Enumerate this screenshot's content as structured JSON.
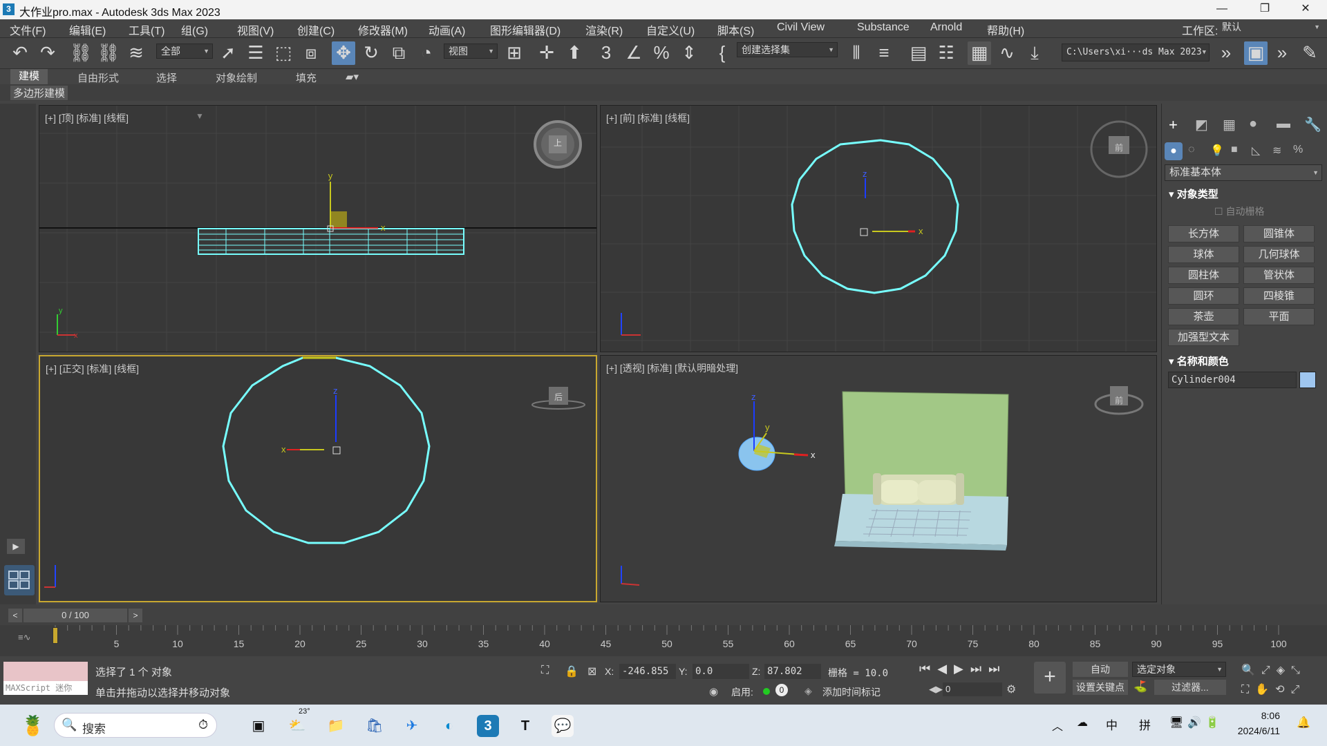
{
  "window": {
    "title": "大作业pro.max - Autodesk 3ds Max 2023",
    "minimize": "—",
    "maximize": "❐",
    "close": "✕"
  },
  "menu": [
    "文件(F)",
    "编辑(E)",
    "工具(T)",
    "组(G)",
    "视图(V)",
    "创建(C)",
    "修改器(M)",
    "动画(A)",
    "图形编辑器(D)",
    "渲染(R)",
    "自定义(U)",
    "脚本(S)",
    "Civil View",
    "Substance",
    "Arnold",
    "帮助(H)"
  ],
  "workspace": {
    "label": "工作区:",
    "value": "默认"
  },
  "toolbar": {
    "filter": "全部",
    "refcoord": "视图",
    "selset": "创建选择集",
    "path": "C:\\Users\\xi···ds Max 2023"
  },
  "ribbon": {
    "tabs": [
      "建模",
      "自由形式",
      "选择",
      "对象绘制",
      "填充"
    ],
    "sub": "多边形建模"
  },
  "viewports": [
    {
      "label": "[+] [顶] [标准] [线框]",
      "cube": "上"
    },
    {
      "label": "[+] [前] [标准] [线框]",
      "cube": "前"
    },
    {
      "label": "[+] [正交] [标准] [线框]",
      "cube": "后"
    },
    {
      "label": "[+] [透视] [标准] [默认明暗处理]",
      "cube": "前"
    }
  ],
  "cmdpanel": {
    "category": "标准基本体",
    "section1": "对象类型",
    "autogrid": "自动栅格",
    "buttons": [
      "长方体",
      "圆锥体",
      "球体",
      "几何球体",
      "圆柱体",
      "管状体",
      "圆环",
      "四棱锥",
      "茶壶",
      "平面",
      "加强型文本"
    ],
    "section2": "名称和颜色",
    "object_name": "Cylinder004",
    "object_color": "#9fc6ef"
  },
  "timeline": {
    "frame": "0 / 100",
    "ticks": [
      "5",
      "10",
      "15",
      "20",
      "25",
      "30",
      "35",
      "40",
      "45",
      "50",
      "55",
      "60",
      "65",
      "70",
      "75",
      "80",
      "85",
      "90",
      "95",
      "100"
    ]
  },
  "status": {
    "script": "MAXScript 迷你",
    "line1": "选择了 1 个 对象",
    "line2": "单击并拖动以选择并移动对象",
    "x_label": "X:",
    "x": "-246.855",
    "y_label": "Y:",
    "y": "0.0",
    "z_label": "Z:",
    "z": "87.802",
    "grid": "栅格 = 10.0",
    "enable": "启用:",
    "addtime": "添加时间标记",
    "auto": "自动",
    "setkey": "设置关键点",
    "selected": "选定对象",
    "filter": "过滤器...",
    "frame_field": "0"
  },
  "taskbar": {
    "search": "搜索",
    "temp": "23°",
    "ime1": "中",
    "ime2": "拼",
    "time": "8:06",
    "date": "2024/6/11"
  }
}
